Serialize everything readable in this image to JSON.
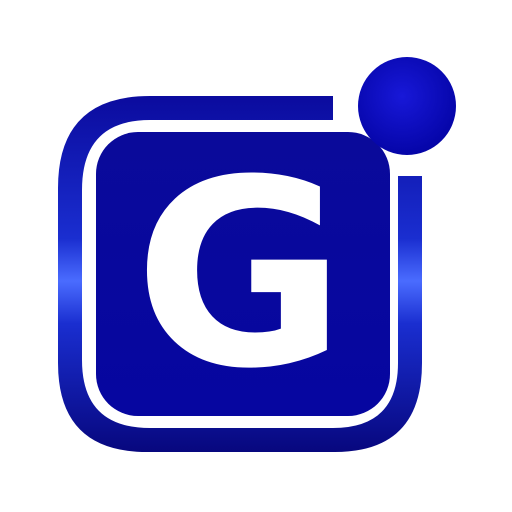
{
  "logo": {
    "letter": "G",
    "icon": "app-logo-icon",
    "colors": {
      "primary": "#0a0a9c",
      "dark": "#06067a",
      "highlight": "#4a6cff",
      "letter": "#ffffff",
      "background": "#ffffff"
    }
  }
}
